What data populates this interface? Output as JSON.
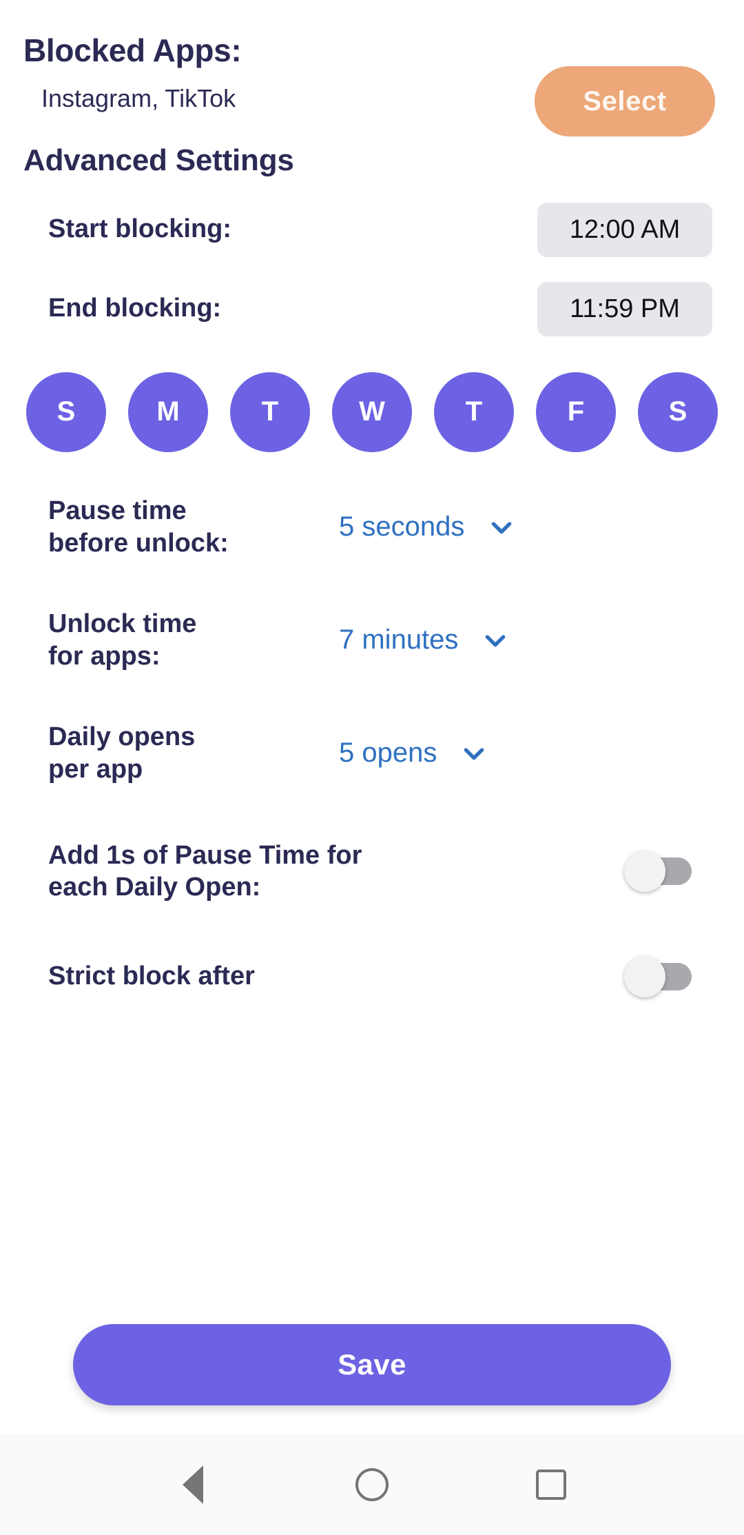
{
  "blocked": {
    "title": "Blocked Apps:",
    "apps": "Instagram, TikTok",
    "select_label": "Select"
  },
  "advanced": {
    "title": "Advanced Settings",
    "start_label": "Start blocking:",
    "start_value": "12:00 AM",
    "end_label": "End blocking:",
    "end_value": "11:59 PM"
  },
  "days": [
    {
      "letter": "S",
      "name": "sunday",
      "selected": true
    },
    {
      "letter": "M",
      "name": "monday",
      "selected": true
    },
    {
      "letter": "T",
      "name": "tuesday",
      "selected": true
    },
    {
      "letter": "W",
      "name": "wednesday",
      "selected": true
    },
    {
      "letter": "T",
      "name": "thursday",
      "selected": true
    },
    {
      "letter": "F",
      "name": "friday",
      "selected": true
    },
    {
      "letter": "S",
      "name": "saturday",
      "selected": true
    }
  ],
  "options": {
    "pause_label": "Pause time\nbefore unlock:",
    "pause_value": "5 seconds",
    "unlock_label": "Unlock time\nfor apps:",
    "unlock_value": "7 minutes",
    "opens_label": "Daily opens\nper app",
    "opens_value": "5 opens",
    "add_pause_label": "Add 1s of Pause Time for each Daily Open:",
    "add_pause_on": false,
    "strict_label": "Strict block after"
  },
  "footer": {
    "save_label": "Save"
  },
  "navbar": {
    "back": "back-button",
    "home": "home-button",
    "recent": "recent-apps-button"
  },
  "colors": {
    "purple": "#6c62e3",
    "orange": "#eda778",
    "navy": "#2b2a54",
    "blue": "#2e70c0",
    "chip_bg": "#e6e7eb"
  }
}
